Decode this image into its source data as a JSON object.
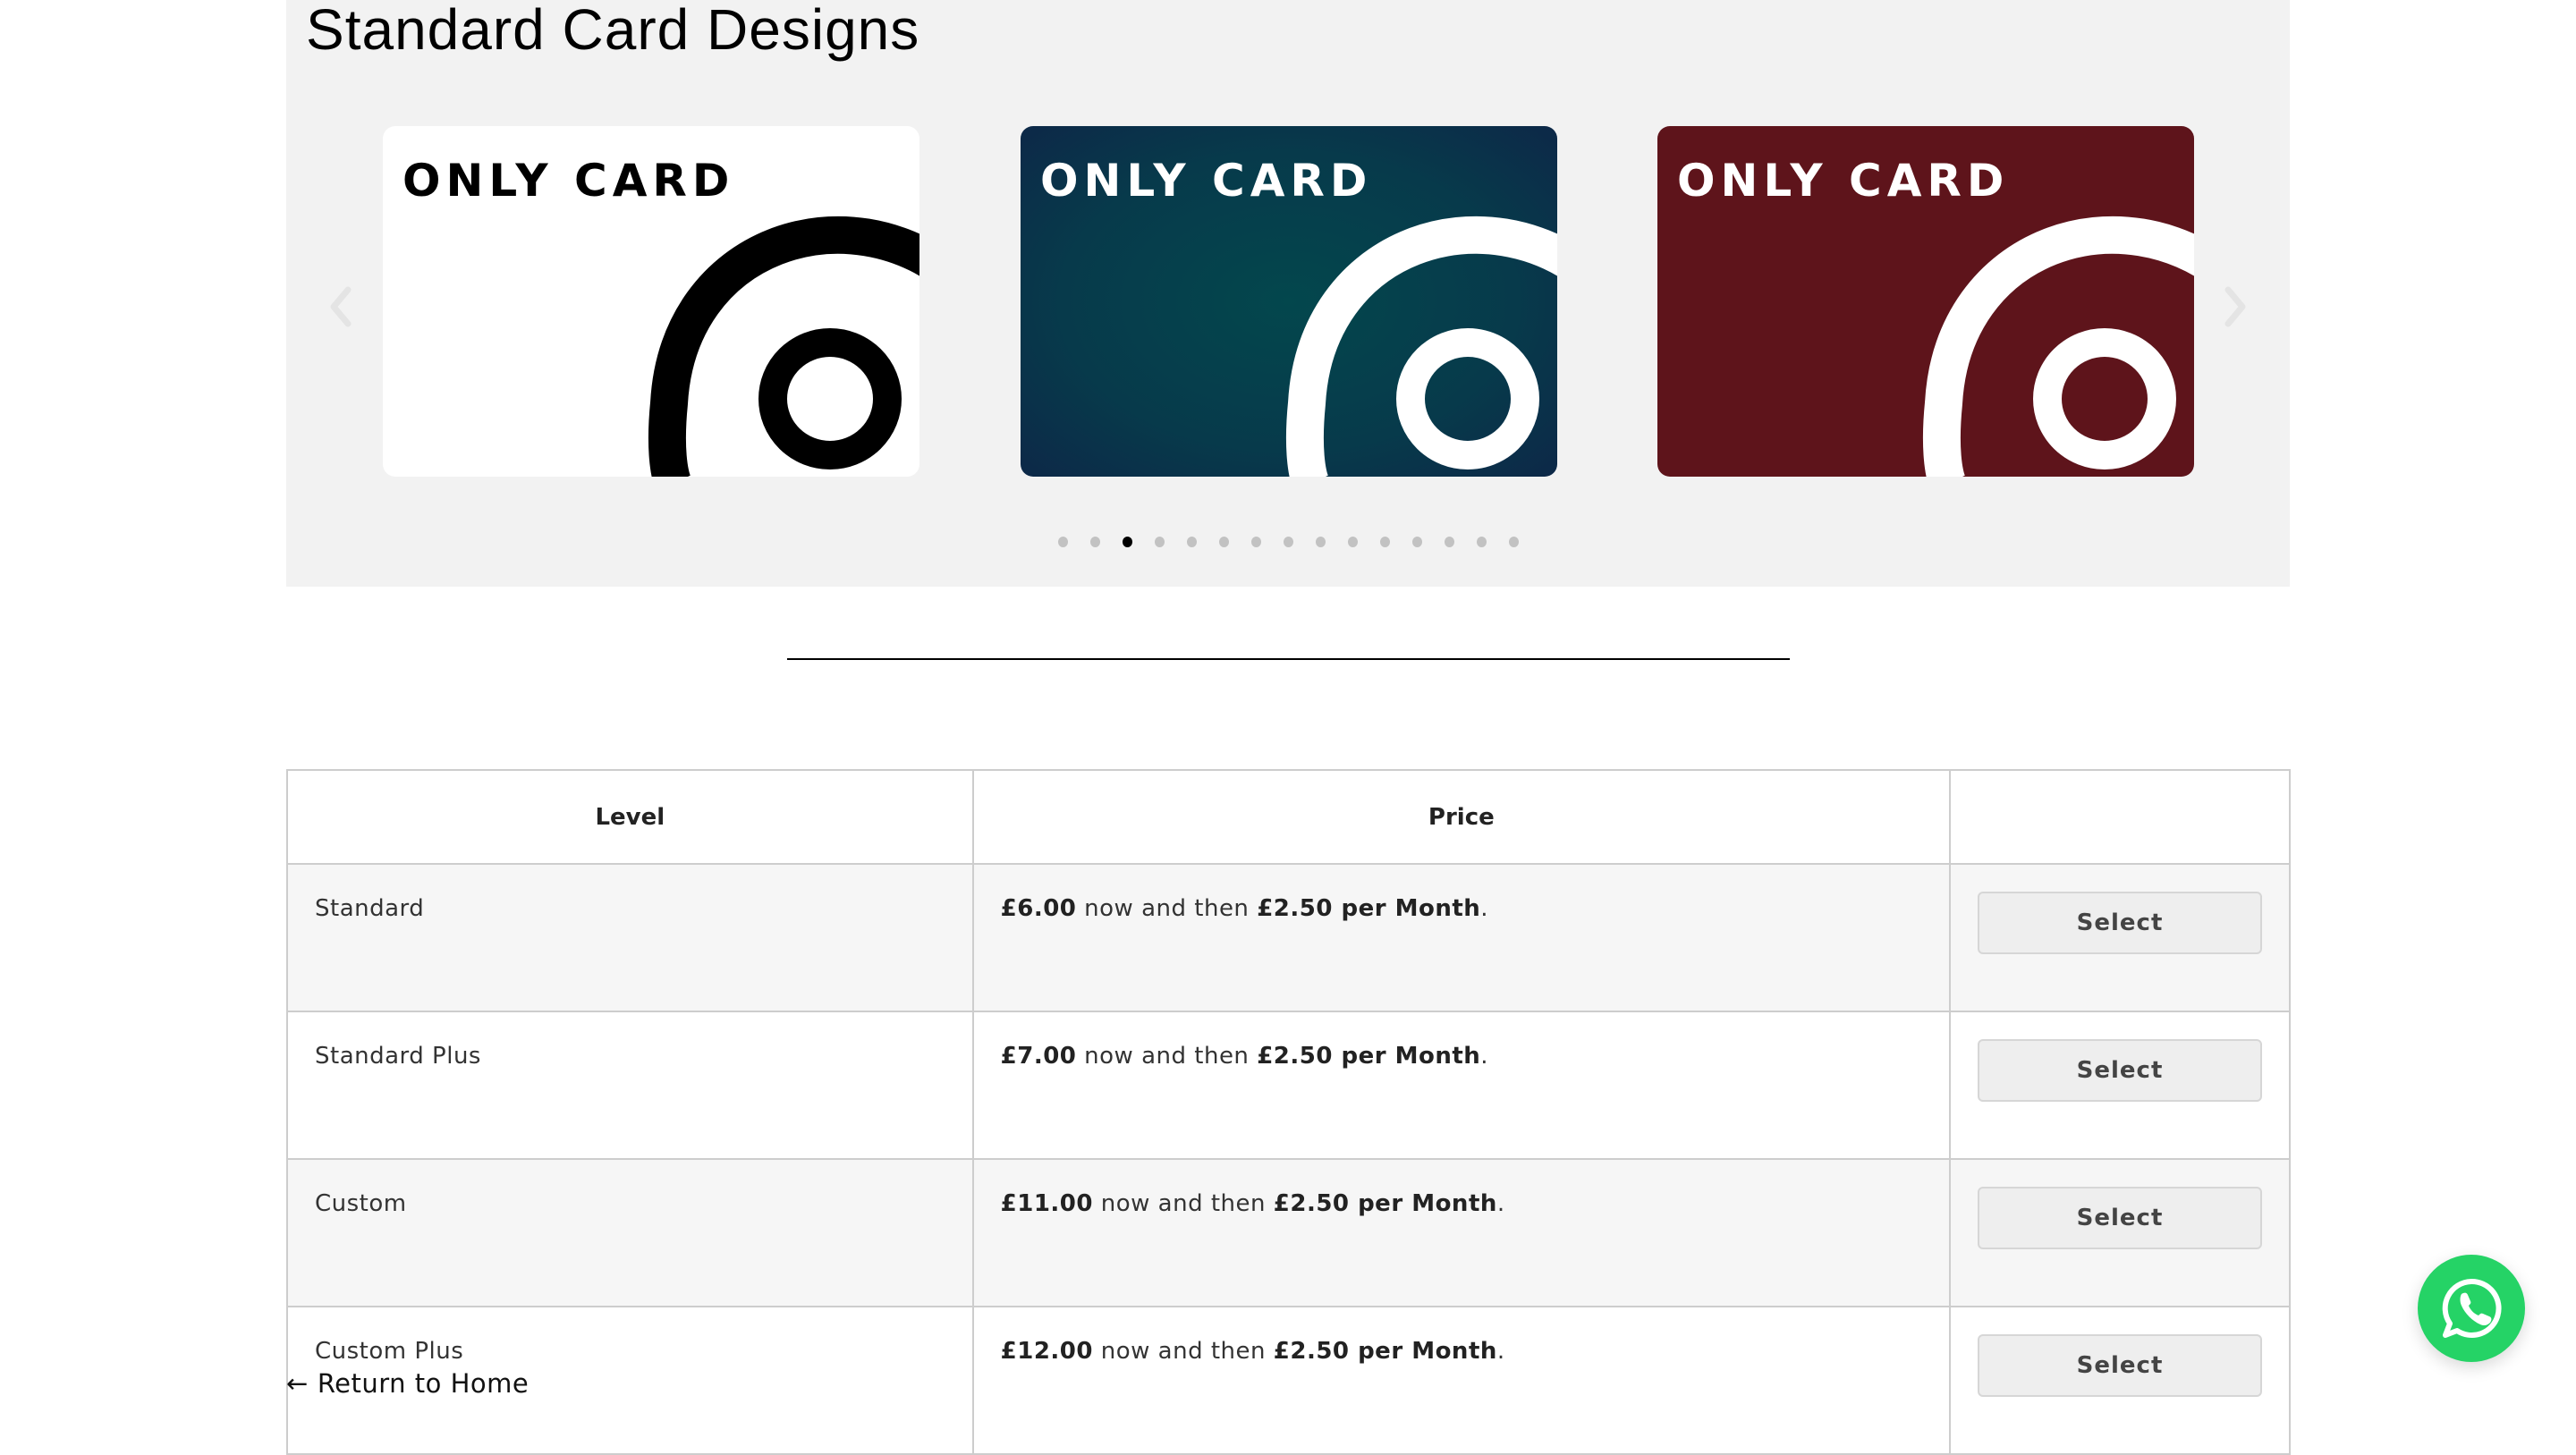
{
  "section": {
    "title": "Standard Card Designs"
  },
  "carousel": {
    "prev_icon": "chevron-left-icon",
    "next_icon": "chevron-right-icon",
    "cards": [
      {
        "brand": "ONLY CARD",
        "theme": "white",
        "bg": "#ffffff",
        "fg": "#000000"
      },
      {
        "brand": "ONLY CARD",
        "theme": "teal",
        "bg": "#044349",
        "fg": "#ffffff"
      },
      {
        "brand": "ONLY CARD",
        "theme": "burgundy",
        "bg": "#5e141b",
        "fg": "#ffffff"
      }
    ],
    "dot_count": 15,
    "active_dot": 3
  },
  "table": {
    "headers": [
      "Level",
      "Price",
      ""
    ],
    "rows": [
      {
        "level": "Standard",
        "price_now": "£6.00",
        "price_mid": " now and then ",
        "price_recurring": "£2.50 per Month",
        "price_end": ".",
        "button": "Select"
      },
      {
        "level": "Standard Plus",
        "price_now": "£7.00",
        "price_mid": " now and then ",
        "price_recurring": "£2.50 per Month",
        "price_end": ".",
        "button": "Select"
      },
      {
        "level": "Custom",
        "price_now": "£11.00",
        "price_mid": " now and then ",
        "price_recurring": "£2.50 per Month",
        "price_end": ".",
        "button": "Select"
      },
      {
        "level": "Custom Plus",
        "price_now": "£12.00",
        "price_mid": " now and then ",
        "price_recurring": "£2.50 per Month",
        "price_end": ".",
        "button": "Select"
      }
    ]
  },
  "footer": {
    "return_arrow": "←",
    "return_label": "Return to Home"
  },
  "whatsapp": {
    "icon": "whatsapp-icon",
    "color": "#25d366"
  }
}
